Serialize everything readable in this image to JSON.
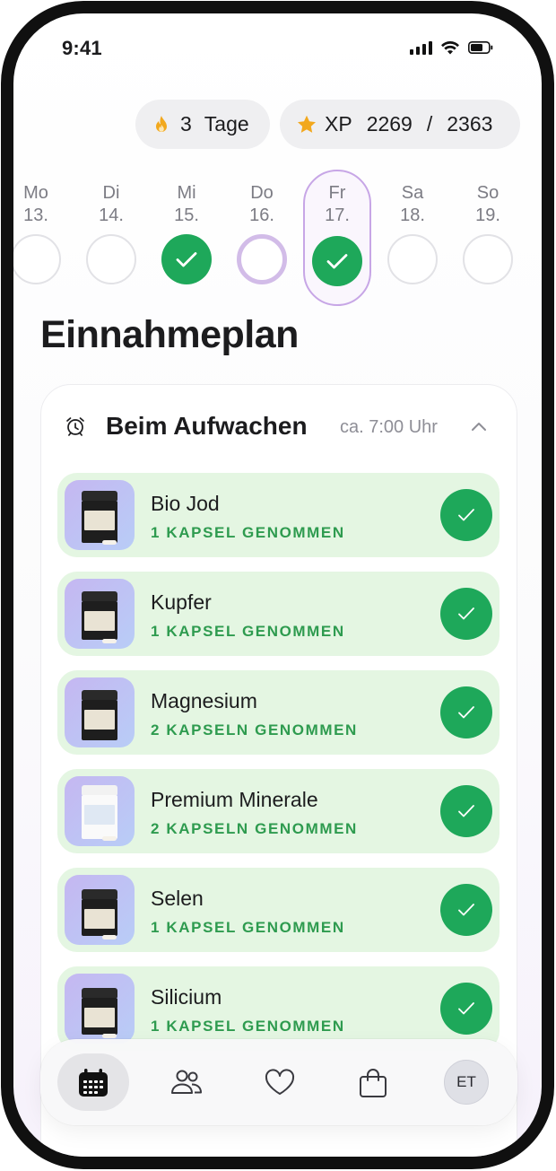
{
  "status_bar": {
    "time": "9:41",
    "icons": [
      "cellular-signal-icon",
      "wifi-icon",
      "battery-icon"
    ]
  },
  "streak": {
    "icon": "flame-icon",
    "count": "3",
    "unit": "Tage"
  },
  "xp": {
    "icon": "star-icon",
    "label": "XP",
    "current": "2269",
    "separator": "/",
    "target": "2363"
  },
  "week": [
    {
      "name": "Mo",
      "date": "13.",
      "status": "empty"
    },
    {
      "name": "Di",
      "date": "14.",
      "status": "empty"
    },
    {
      "name": "Mi",
      "date": "15.",
      "status": "done"
    },
    {
      "name": "Do",
      "date": "16.",
      "status": "partial"
    },
    {
      "name": "Fr",
      "date": "17.",
      "status": "done",
      "selected": true
    },
    {
      "name": "Sa",
      "date": "18.",
      "status": "empty"
    },
    {
      "name": "So",
      "date": "19.",
      "status": "empty"
    }
  ],
  "page_title": "Einnahmeplan",
  "section": {
    "icon": "alarm-clock-icon",
    "title": "Beim Aufwachen",
    "time": "ca. 7:00 Uhr",
    "expanded": true,
    "items": [
      {
        "name": "Bio Jod",
        "status": "1 KAPSEL GENOMMEN",
        "taken": true
      },
      {
        "name": "Kupfer",
        "status": "1 KAPSEL GENOMMEN",
        "taken": true
      },
      {
        "name": "Magnesium",
        "status": "2 KAPSELN GENOMMEN",
        "taken": true
      },
      {
        "name": "Premium Minerale",
        "status": "2 KAPSELN GENOMMEN",
        "taken": true
      },
      {
        "name": "Selen",
        "status": "1 KAPSEL GENOMMEN",
        "taken": true
      },
      {
        "name": "Silicium",
        "status": "1 KAPSEL GENOMMEN",
        "taken": true
      }
    ]
  },
  "tab_bar": {
    "tabs": [
      {
        "icon": "calendar-icon",
        "active": true
      },
      {
        "icon": "community-icon",
        "active": false
      },
      {
        "icon": "heart-icon",
        "active": false
      },
      {
        "icon": "shopping-bag-icon",
        "active": false
      },
      {
        "icon": "profile-avatar",
        "initials": "ET",
        "active": false
      }
    ]
  },
  "colors": {
    "success": "#1ea85a",
    "success_bg": "#e4f6e2",
    "success_text": "#2e9b4f",
    "selected_day": "#c7a6e6",
    "star": "#f2a81d",
    "flame": "#f2a81d"
  }
}
